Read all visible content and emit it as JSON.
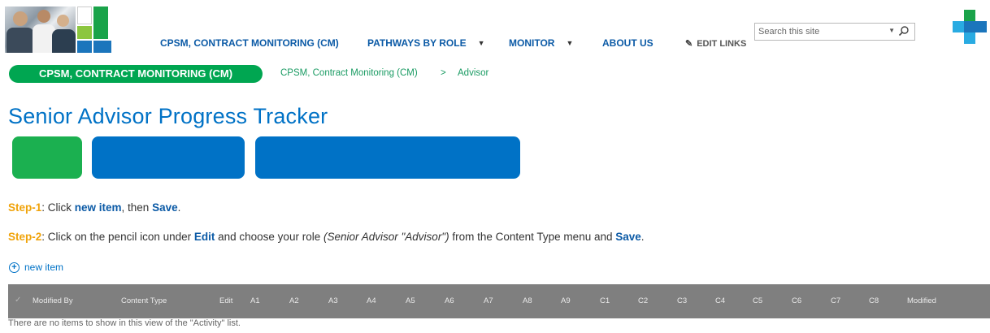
{
  "colors": {
    "brand_blue": "#0072c6",
    "nav_blue": "#0b5aa6",
    "brand_green": "#00a651",
    "step_orange": "#f0a30a",
    "header_gray": "#7f7f7f"
  },
  "nav": {
    "items": [
      {
        "label": "CPSM, CONTRACT MONITORING (CM)"
      },
      {
        "label": "PATHWAYS BY ROLE"
      },
      {
        "label": "MONITOR"
      },
      {
        "label": "ABOUT US"
      }
    ],
    "edit_links": "EDIT LINKS"
  },
  "search": {
    "placeholder": "Search this site"
  },
  "breadcrumb": {
    "site": "CPSM, CONTRACT MONITORING (CM)",
    "path1": "CPSM, Contract Monitoring (CM)",
    "separator": ">",
    "path2": "Advisor"
  },
  "page": {
    "title": "Senior Advisor Progress Tracker"
  },
  "steps": {
    "step1": {
      "label": "Step-1",
      "t1": ": Click ",
      "new_item": "new item",
      "t2": ", then ",
      "save": "Save",
      "t3": "."
    },
    "step2": {
      "label": "Step-2",
      "t1": ": Click on the pencil icon under ",
      "edit": "Edit",
      "t2": " and choose your role ",
      "role": "(Senior Advisor \"Advisor\")",
      "t3": " from the Content Type menu and ",
      "save": "Save",
      "t4": "."
    }
  },
  "list": {
    "new_item_label": "new item",
    "columns": [
      "Modified By",
      "Content Type",
      "Edit",
      "A1",
      "A2",
      "A3",
      "A4",
      "A5",
      "A6",
      "A7",
      "A8",
      "A9",
      "C1",
      "C2",
      "C3",
      "C4",
      "C5",
      "C6",
      "C7",
      "C8",
      "Modified"
    ],
    "empty_message": "There are no items to show in this view of the \"Activity\" list."
  },
  "icons": {
    "pencil": "pencil-icon",
    "search": "search-icon",
    "dropdown": "chevron-down-icon",
    "add": "plus-circle-icon",
    "check": "checkmark-icon"
  }
}
